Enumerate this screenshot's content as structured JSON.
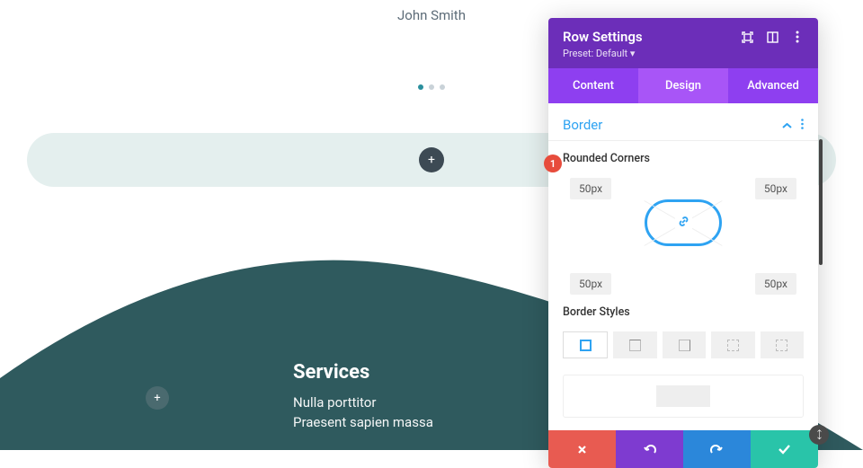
{
  "author": "John Smith",
  "panel": {
    "title": "Row Settings",
    "preset": "Preset: Default ▾",
    "tabs": {
      "content": "Content",
      "design": "Design",
      "advanced": "Advanced"
    },
    "section": "Border",
    "rounded_label": "Rounded Corners",
    "corners": {
      "tl": "50px",
      "tr": "50px",
      "bl": "50px",
      "br": "50px"
    },
    "styles_label": "Border Styles"
  },
  "badge": "1",
  "services": {
    "heading": "Services",
    "line1": "Nulla porttitor",
    "line2": "Praesent sapien massa"
  }
}
